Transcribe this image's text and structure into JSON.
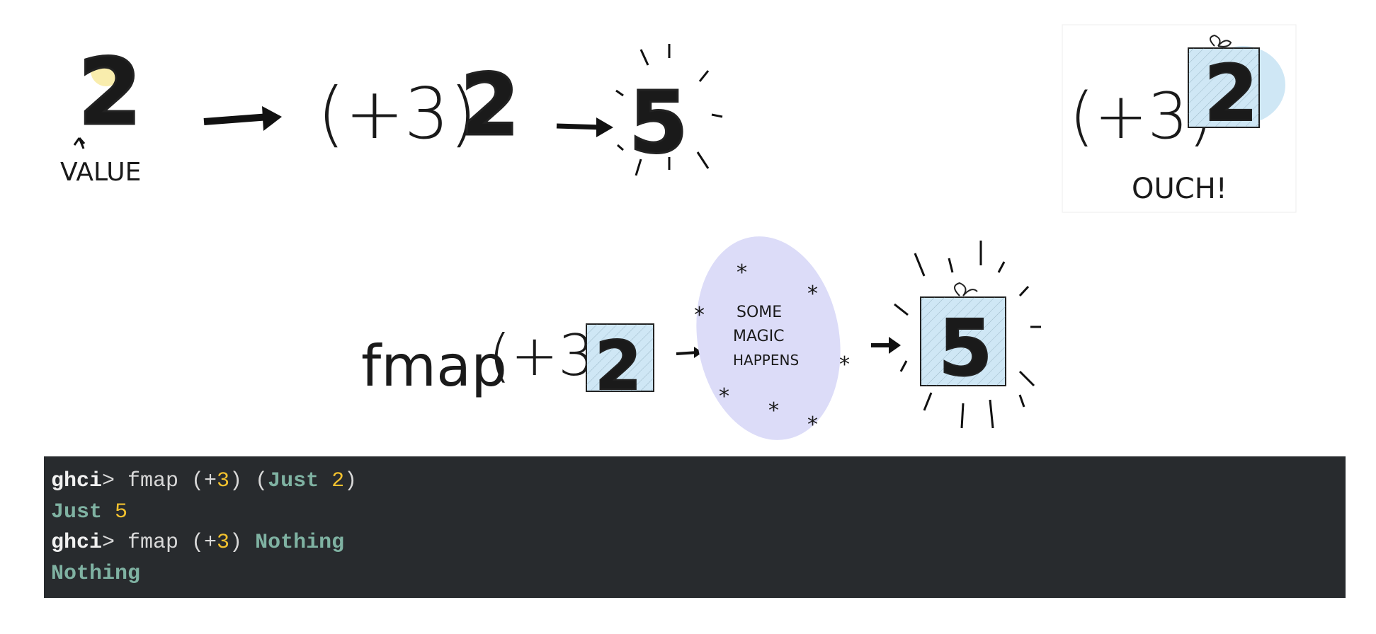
{
  "illustration": {
    "value_digit": "2",
    "value_label": "VALUE",
    "function_label": "(+3)",
    "result_digit": "5",
    "ouch_label": "OUCH!",
    "fmap_label": "fmap",
    "magic_lines": [
      "SOME",
      "MAGIC",
      "HAPPENS"
    ],
    "colors": {
      "number": "#f7e58a",
      "box": "#cfe7f5",
      "magic": "#dcdcf8"
    }
  },
  "terminal": {
    "lines": [
      [
        {
          "t": "ghci",
          "c": "p"
        },
        {
          "t": "> fmap (+"
        },
        {
          "t": "3",
          "c": "n"
        },
        {
          "t": ") ("
        },
        {
          "t": "Just",
          "c": "k"
        },
        {
          "t": " "
        },
        {
          "t": "2",
          "c": "n"
        },
        {
          "t": ")"
        }
      ],
      [
        {
          "t": "Just",
          "c": "k"
        },
        {
          "t": " "
        },
        {
          "t": "5",
          "c": "n"
        }
      ],
      [
        {
          "t": "ghci",
          "c": "p"
        },
        {
          "t": "> fmap (+"
        },
        {
          "t": "3",
          "c": "n"
        },
        {
          "t": ") "
        },
        {
          "t": "Nothing",
          "c": "k"
        }
      ],
      [
        {
          "t": "Nothing",
          "c": "k"
        }
      ]
    ],
    "colors": {
      "background": "#282b2e",
      "prompt": "#f0f0f0",
      "constructor": "#7fb2a2",
      "number": "#f2c12e"
    }
  }
}
